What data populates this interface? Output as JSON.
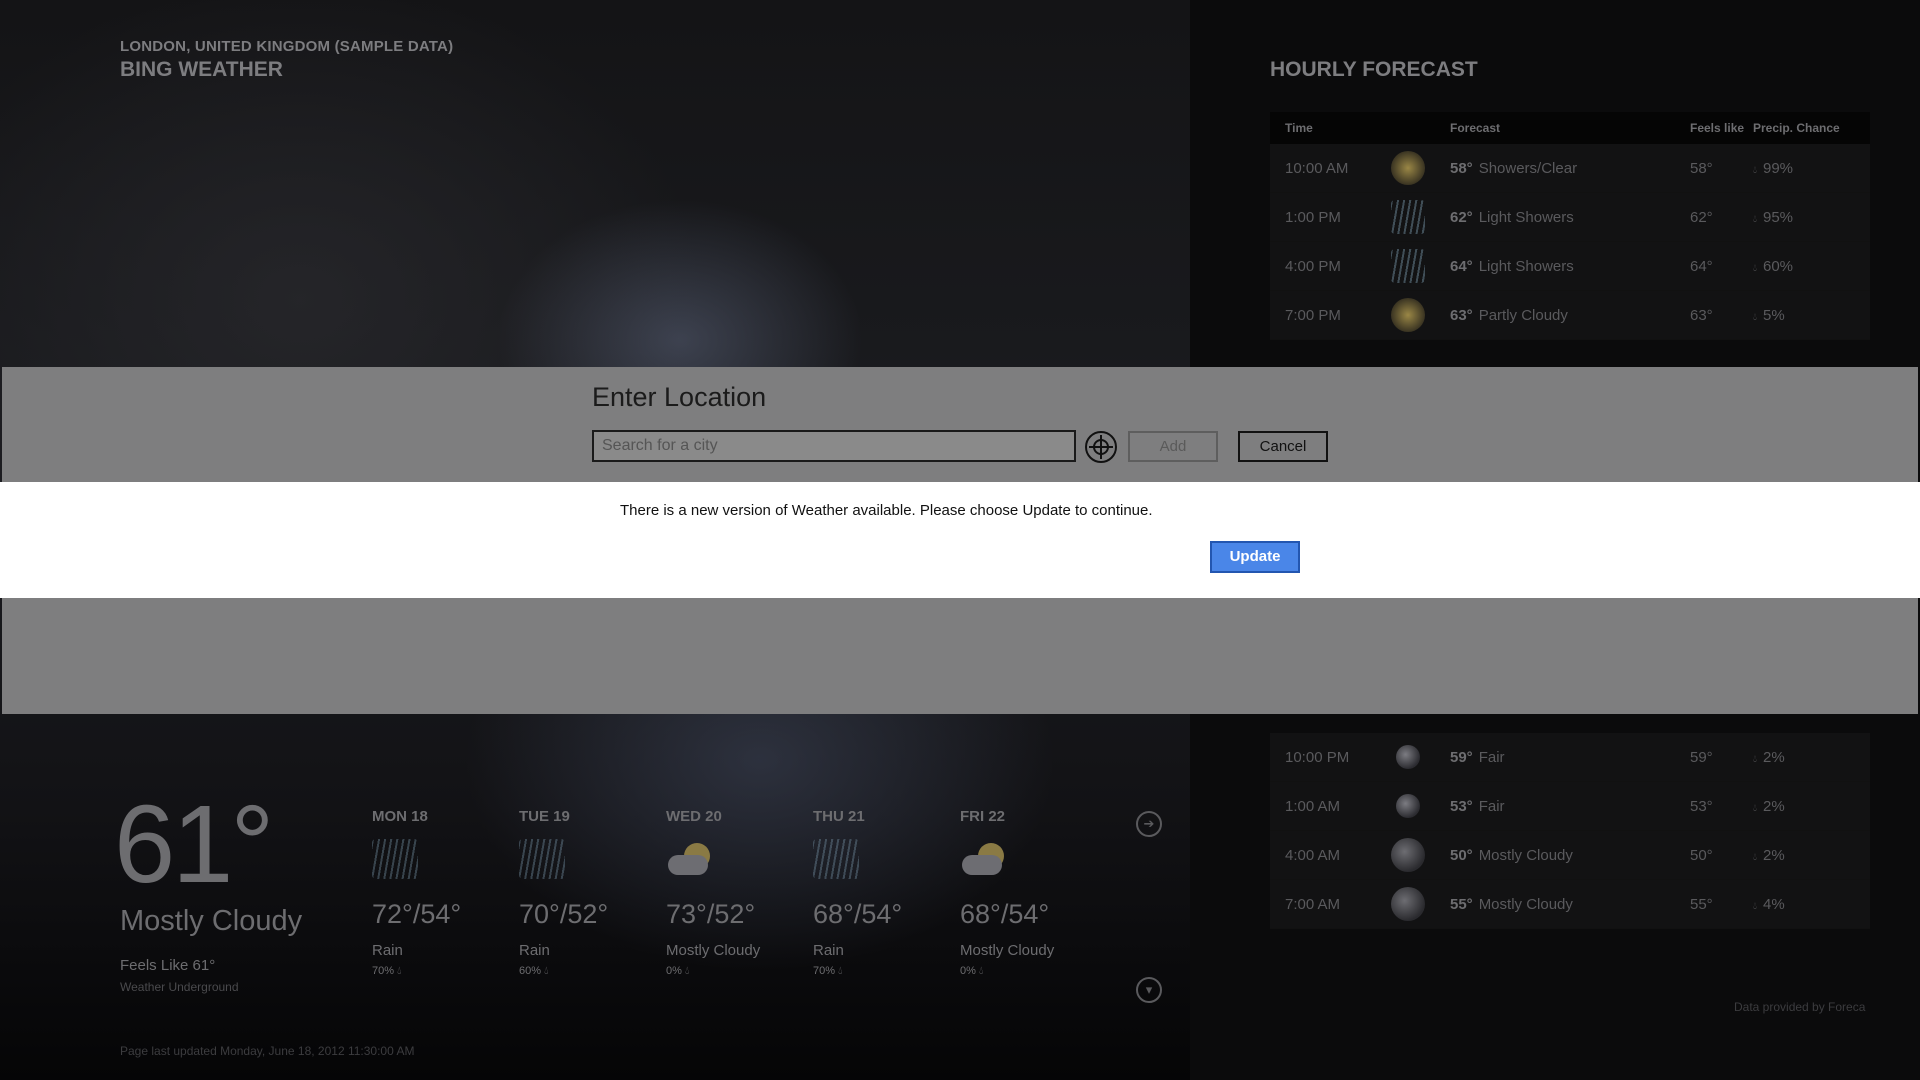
{
  "app": {
    "location": "LONDON, UNITED KINGDOM (SAMPLE DATA)",
    "title": "BING WEATHER"
  },
  "current": {
    "temp": "61°",
    "condition": "Mostly Cloudy",
    "feels_like": "Feels Like 61°",
    "source": "Weather Underground",
    "last_updated": "Page last updated Monday, June 18, 2012 11:30:00 AM"
  },
  "daily": [
    {
      "day": "MON 18",
      "temps": "72°/54°",
      "condition": "Rain",
      "precip": "70%",
      "icon": "rain-icon"
    },
    {
      "day": "TUE 19",
      "temps": "70°/52°",
      "condition": "Rain",
      "precip": "60%",
      "icon": "rain-icon"
    },
    {
      "day": "WED 20",
      "temps": "73°/52°",
      "condition": "Mostly Cloudy",
      "precip": "0%",
      "icon": "mostly-cloudy-icon"
    },
    {
      "day": "THU 21",
      "temps": "68°/54°",
      "condition": "Rain",
      "precip": "70%",
      "icon": "rain-icon"
    },
    {
      "day": "FRI 22",
      "temps": "68°/54°",
      "condition": "Mostly Cloudy",
      "precip": "0%",
      "icon": "mostly-cloudy-icon"
    }
  ],
  "hourly": {
    "title": "HOURLY FORECAST",
    "columns": {
      "time": "Time",
      "forecast": "Forecast",
      "feels": "Feels like",
      "precip": "Precip. Chance"
    },
    "rows_top": [
      {
        "time": "10:00 AM",
        "temp": "58°",
        "forecast": "Showers/Clear",
        "feels": "58°",
        "precip": "99%",
        "icon": "sun-icon"
      },
      {
        "time": "1:00 PM",
        "temp": "62°",
        "forecast": "Light Showers",
        "feels": "62°",
        "precip": "95%",
        "icon": "rain-icon"
      },
      {
        "time": "4:00 PM",
        "temp": "64°",
        "forecast": "Light Showers",
        "feels": "64°",
        "precip": "60%",
        "icon": "rain-icon"
      },
      {
        "time": "7:00 PM",
        "temp": "63°",
        "forecast": "Partly Cloudy",
        "feels": "63°",
        "precip": "5%",
        "icon": "partly-cloudy-icon"
      }
    ],
    "rows_bottom": [
      {
        "time": "10:00 PM",
        "temp": "59°",
        "forecast": "Fair",
        "feels": "59°",
        "precip": "2%",
        "icon": "moon-icon"
      },
      {
        "time": "1:00 AM",
        "temp": "53°",
        "forecast": "Fair",
        "feels": "53°",
        "precip": "2%",
        "icon": "moon-icon"
      },
      {
        "time": "4:00 AM",
        "temp": "50°",
        "forecast": "Mostly Cloudy",
        "feels": "50°",
        "precip": "2%",
        "icon": "mostly-cloudy-icon"
      },
      {
        "time": "7:00 AM",
        "temp": "55°",
        "forecast": "Mostly Cloudy",
        "feels": "55°",
        "precip": "4%",
        "icon": "mostly-cloudy-icon"
      }
    ],
    "provider": "Data provided by Foreca"
  },
  "location_dialog": {
    "title": "Enter Location",
    "search_placeholder": "Search for a city",
    "search_value": "",
    "add_label": "Add",
    "cancel_label": "Cancel"
  },
  "update_notice": {
    "message": "There is a new version of Weather available. Please choose Update to continue.",
    "button_label": "Update"
  },
  "colors": {
    "update_button": "#4a86e8",
    "dialog_band": "#7e7e7f",
    "background": "#0b0b0c"
  }
}
